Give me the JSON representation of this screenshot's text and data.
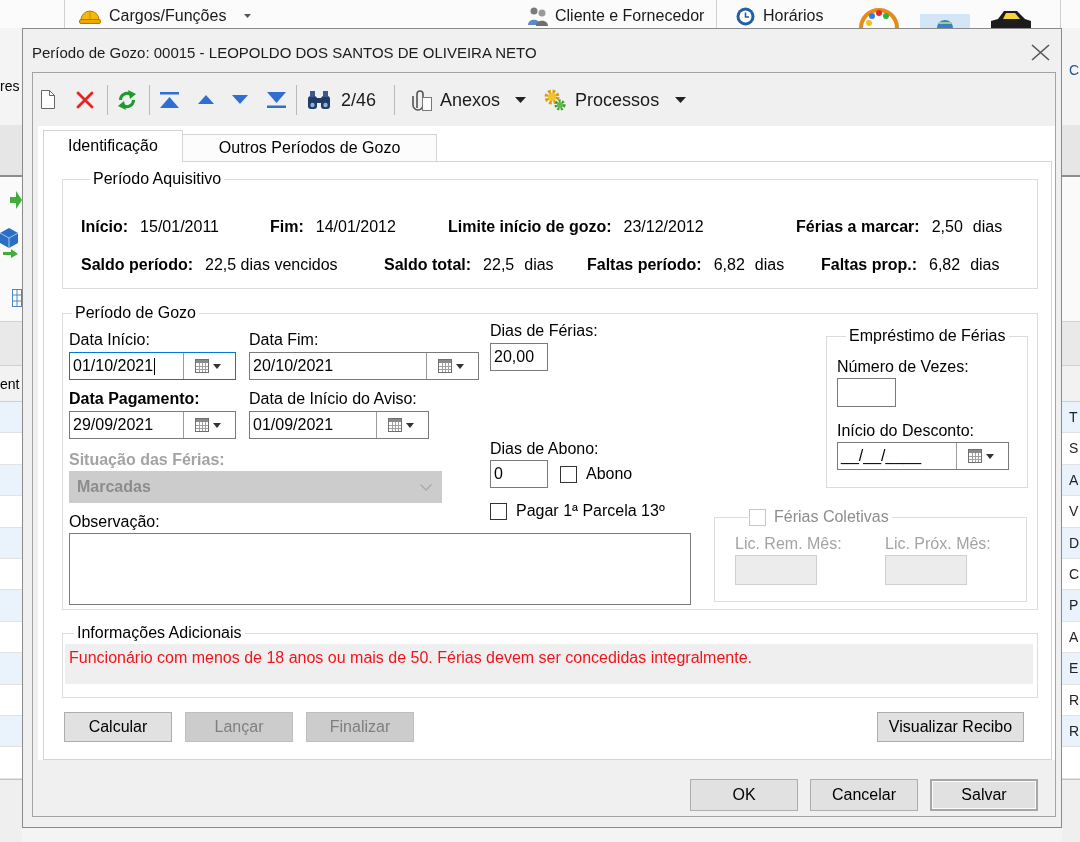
{
  "background_window": {
    "menu": [
      {
        "label": "Cargos/Funções",
        "dropdown": true
      },
      {
        "label": "Cliente e Fornecedor",
        "dropdown": false
      },
      {
        "label": "Horários",
        "dropdown": false
      }
    ],
    "left_edge": {
      "toolbar_text": "res",
      "column_header": "ent"
    },
    "right_edge": {
      "toolbar_text": "C",
      "cells": [
        "T",
        "S",
        "A",
        "V",
        "D",
        "C",
        "P",
        "A",
        "E",
        "R",
        "R"
      ]
    }
  },
  "window": {
    "title": "Período de Gozo: 00015 - LEOPOLDO DOS SANTOS DE OLIVEIRA NETO"
  },
  "toolbar": {
    "record_position": "2/46",
    "menus": [
      {
        "label": "Anexos",
        "dropdown": true
      },
      {
        "label": "Processos",
        "dropdown": true
      }
    ]
  },
  "tabs": [
    {
      "label": "Identificação",
      "selected": true
    },
    {
      "label": "Outros Períodos de Gozo",
      "selected": false
    }
  ],
  "periodo_aquisitivo": {
    "title": "Período Aquisitivo",
    "lines": [
      {
        "fields": [
          {
            "label": "Início:",
            "value": "15/01/2011"
          },
          {
            "label": "Fim:",
            "value": "14/01/2012"
          },
          {
            "label": "Limite início de gozo:",
            "value": "23/12/2012"
          },
          {
            "label": "Férias a marcar:",
            "value": "2,50",
            "unit": "dias"
          }
        ]
      },
      {
        "fields": [
          {
            "label": "Saldo período:",
            "value": "22,5 dias vencidos"
          },
          {
            "label": "Saldo total:",
            "value": "22,5",
            "unit": "dias"
          },
          {
            "label": "Faltas período:",
            "value": "6,82",
            "unit": "dias"
          },
          {
            "label": "Faltas prop.:",
            "value": "6,82",
            "unit": "dias"
          }
        ]
      }
    ]
  },
  "periodo_gozo": {
    "title": "Período de Gozo",
    "dates": [
      {
        "label": "Data Início:",
        "value": "01/10/2021",
        "required": false,
        "focused": true
      },
      {
        "label": "Data Fim:",
        "value": "20/10/2021",
        "required": false,
        "focused": false
      },
      {
        "label": "Data Pagamento:",
        "value": "29/09/2021",
        "required": true,
        "focused": false
      },
      {
        "label": "Data de Início do Aviso:",
        "value": "01/09/2021",
        "required": false,
        "focused": false
      }
    ],
    "situacao": {
      "label": "Situação das Férias:",
      "value": "Marcadas",
      "required": true,
      "disabled": true
    },
    "observacao": {
      "label": "Observação:"
    },
    "dias_ferias": {
      "label": "Dias de Férias:",
      "value": "20,00"
    },
    "dias_abono": {
      "label": "Dias de Abono:",
      "value": "0"
    },
    "abono": {
      "label": "Abono",
      "checked": false
    },
    "pagar_parcela": {
      "label": "Pagar 1ª Parcela 13º",
      "checked": false
    },
    "emprestimo": {
      "title": "Empréstimo de Férias",
      "numero_vezes": {
        "label": "Número de Vezes:"
      },
      "inicio_desconto": {
        "label": "Início do Desconto:",
        "value": "__/__/____"
      }
    },
    "ferias_coletivas": {
      "label": "Férias Coletivas",
      "checked": false,
      "disabled": true,
      "fields": [
        {
          "label": "Lic. Rem. Mês:"
        },
        {
          "label": "Lic. Próx. Mês:"
        }
      ]
    }
  },
  "informacoes_adicionais": {
    "title": "Informações Adicionais",
    "message": "Funcionário com menos de 18 anos ou mais de 50. Férias devem ser concedidas integralmente."
  },
  "actions": [
    {
      "label": "Calcular",
      "disabled": false
    },
    {
      "label": "Lançar",
      "disabled": true
    },
    {
      "label": "Finalizar",
      "disabled": true
    },
    {
      "label": "Visualizar Recibo",
      "disabled": false
    }
  ],
  "footer": [
    {
      "label": "OK",
      "default": false
    },
    {
      "label": "Cancelar",
      "default": false
    },
    {
      "label": "Salvar",
      "default": true
    }
  ]
}
